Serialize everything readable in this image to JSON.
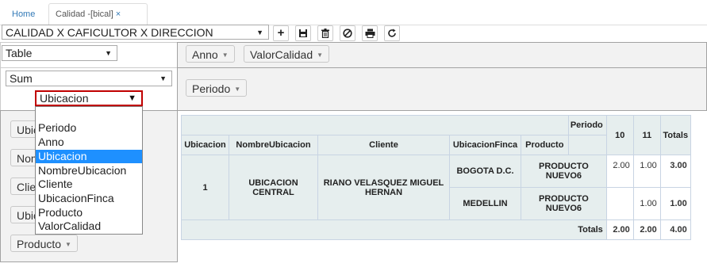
{
  "tabs": {
    "home": "Home",
    "active": "Calidad -[bical]",
    "close": "×"
  },
  "report_select": {
    "value": "CALIDAD X CAFICULTOR X DIRECCION"
  },
  "toolbar": {
    "add_icon": "plus-icon",
    "save_icon": "floppy-icon",
    "delete_icon": "trash-icon",
    "cancel_icon": "ban-icon",
    "print_icon": "print-icon",
    "refresh_icon": "refresh-icon"
  },
  "renderer_select": {
    "value": "Table"
  },
  "aggregator_select": {
    "value": "Sum"
  },
  "attribute_select": {
    "value": "Ubicacion",
    "options": [
      "",
      "Periodo",
      "Anno",
      "Ubicacion",
      "NombreUbicacion",
      "Cliente",
      "UbicacionFinca",
      "Producto",
      "ValorCalidad"
    ],
    "highlighted": "Ubicacion"
  },
  "column_fields": [
    "Anno",
    "ValorCalidad"
  ],
  "row_fields_top": [
    "Periodo"
  ],
  "unused_fields": [
    "Ubic",
    "Nom",
    "Clie",
    "Ubic",
    "Producto"
  ],
  "pivot": {
    "col_attr_label": "Periodo",
    "headers": [
      "Ubicacion",
      "NombreUbicacion",
      "Cliente",
      "UbicacionFinca",
      "Producto"
    ],
    "col_keys": [
      "10",
      "11"
    ],
    "totals_label": "Totals",
    "row_group": {
      "ubicacion": "1",
      "nombre": "UBICACION CENTRAL",
      "cliente": "RIANO VELASQUEZ MIGUEL HERNAN"
    },
    "rows": [
      {
        "finca": "BOGOTA D.C.",
        "producto": "PRODUCTO NUEVO6",
        "v10": "2.00",
        "v11": "1.00",
        "total": "3.00"
      },
      {
        "finca": "MEDELLIN",
        "producto": "PRODUCTO NUEVO6",
        "v10": "",
        "v11": "1.00",
        "total": "1.00"
      }
    ],
    "col_totals": {
      "label": "Totals",
      "v10": "2.00",
      "v11": "2.00",
      "total": "4.00"
    }
  },
  "colors": {
    "highlight": "#1e90ff",
    "link": "#337ab7",
    "attr_border": "#c00000"
  }
}
